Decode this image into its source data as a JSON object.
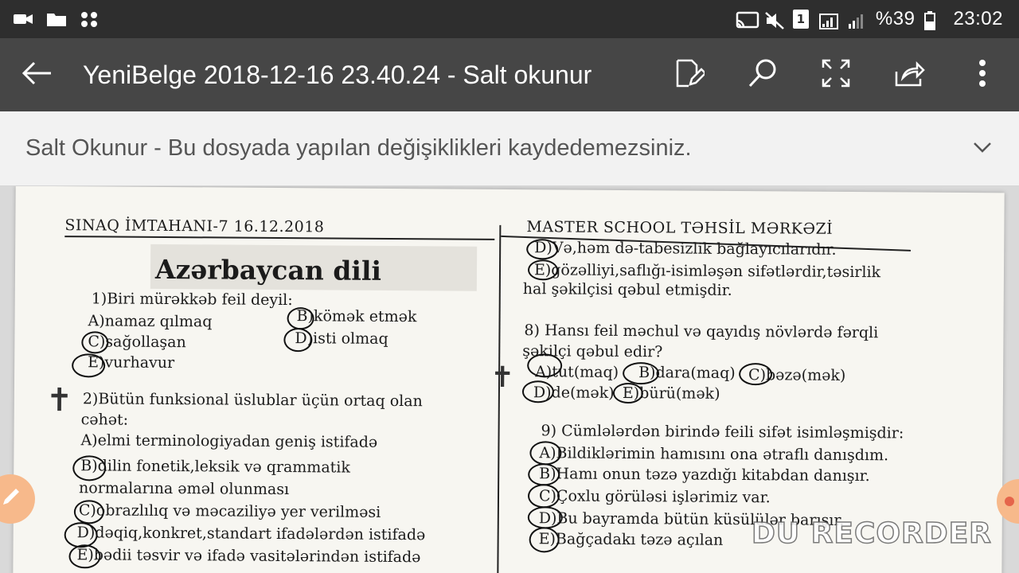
{
  "status_bar": {
    "battery": "%39",
    "time": "23:02",
    "sim": "1"
  },
  "app_bar": {
    "title": "YeniBelge 2018-12-16 23.40.24 - Salt okunur"
  },
  "banner": {
    "text": "Salt Okunur - Bu dosyada yapılan değişiklikleri kaydedemezsiniz."
  },
  "document": {
    "header_left": "SINAQ İMTAHANI-7  16.12.2018",
    "header_right": "MASTER SCHOOL TƏHSİL MƏRKƏZİ",
    "subject": "Azərbaycan dili",
    "q1": {
      "question": "1)Biri mürəkkəb feil deyil:",
      "a": "A)namaz qılmaq",
      "b": "B)kömək etmək",
      "c": "C)sağollaşan",
      "d": "D)isti olmaq",
      "e": "E)vurhavur"
    },
    "q2": {
      "question": "2)Bütün funksional üslublar üçün ortaq olan",
      "question_2": "cəhət:",
      "a": "A)elmi terminologiyadan geniş istifadə",
      "b": "B)dilin fonetik,leksik və qrammatik",
      "b_2": "normalarına əməl olunması",
      "c": "C)obrazlılıq və məcaziliyə yer verilməsi",
      "d": "D)dəqiq,konkret,standart ifadələrdən istifadə",
      "e": "E)bədii təsvir və ifadə vasitələrindən istifadə"
    },
    "q7_tail": {
      "d": "D)Və,həm də-tabesizlik bağlayıcılarıdır.",
      "e": "E)gözəlliyi,saflığı-isimləşən sifətlərdir,təsirlik",
      "e_2": "hal şəkilçisi qəbul etmişdir."
    },
    "q8": {
      "question": "8) Hansı feil məchul və qayıdış növlərdə fərqli",
      "question_2": "şəkilçi qəbul edir?",
      "a": "A)tut(maq)",
      "b": "B)dara(maq)",
      "c": "C)bəzə(mək)",
      "d": "D)de(mək)",
      "e": "E)bürü(mək)"
    },
    "q9": {
      "question": "9) Cümlələrdən birində feili sifət isimləşmişdir:",
      "a": "A)Bildiklərimin hamısını ona ətraflı danışdım.",
      "b": "B)Hamı onun təzə yazdığı kitabdan danışır.",
      "c": "C)Çoxlu görüləsi işlərimiz var.",
      "d": "D)Bu bayramda bütün küsülülər barışır.",
      "e": "E)Bağçadakı təzə açılan"
    },
    "watermark": "DU RECORDER"
  },
  "icons": {
    "back": "back-arrow-icon",
    "edit": "edit-icon",
    "search": "search-icon",
    "fullscreen": "fullscreen-icon",
    "share": "share-icon",
    "more": "more-vert-icon",
    "expand": "chevron-down-icon"
  }
}
